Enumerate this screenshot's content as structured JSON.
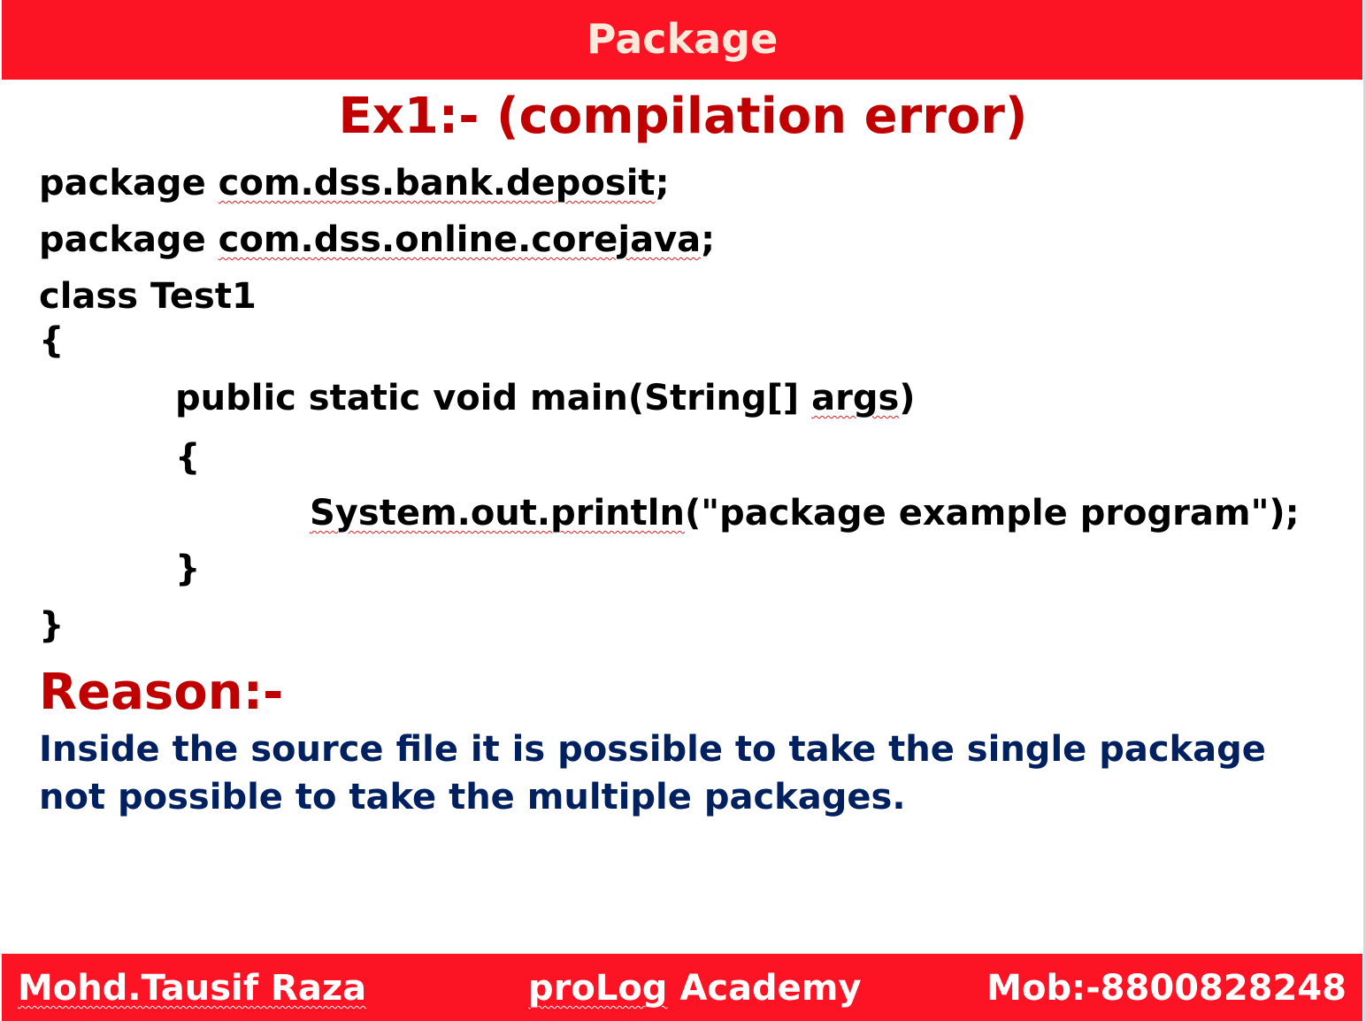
{
  "header": {
    "title": "Package"
  },
  "example": {
    "title": "Ex1:- (compilation error)"
  },
  "code": {
    "line1_keyword": "package ",
    "line1_name": "com.dss.bank.deposit",
    "line1_end": ";",
    "line2_keyword": "package ",
    "line2_name": "com.dss.online.corejava",
    "line2_end": ";",
    "line3": "class Test1",
    "line4": "{",
    "line5_start": "public static void main(String[] ",
    "line5_args": "args",
    "line5_end": ")",
    "line6": "{",
    "line7_call": "System.out.println",
    "line7_rest": "(\"package example program\");",
    "line8": "}",
    "line9": "}"
  },
  "reason": {
    "heading": "Reason:-",
    "line1": "Inside the source file it is possible to take the single package",
    "line2": "not possible to take the multiple packages."
  },
  "footer": {
    "author": "Mohd.Tausif Raza",
    "academy_name": "proLog",
    "academy_suffix": " Academy",
    "mobile": "Mob:-8800828248"
  }
}
